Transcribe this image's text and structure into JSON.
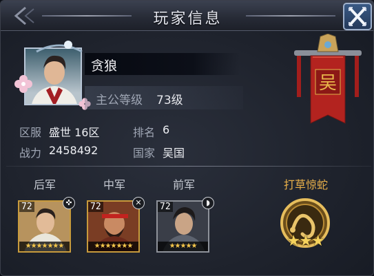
{
  "header": {
    "title": "玩家信息"
  },
  "player": {
    "name": "贪狼",
    "level_label": "主公等级",
    "level_value": "73级",
    "info": {
      "server_label": "区服",
      "server_value": "盛世 16区",
      "rank_label": "排名",
      "rank_value": "6",
      "power_label": "战力",
      "power_value": "2458492",
      "nation_label": "国家",
      "nation_value": "吴国"
    }
  },
  "banner": {
    "glyph": "吴",
    "color": "#b3231f"
  },
  "armies": [
    {
      "title": "后军",
      "hero_level": "72",
      "stars": "★★★★★★★",
      "badge": "✜"
    },
    {
      "title": "中军",
      "hero_level": "72",
      "stars": "★★★★★★★",
      "badge": "✕"
    },
    {
      "title": "前军",
      "hero_level": "72",
      "stars": "★★★★★",
      "badge": "◗"
    }
  ],
  "skill": {
    "title": "打草惊蛇",
    "stars": "★★★",
    "glyph": "艹"
  },
  "colors": {
    "accent_gold": "#e9b04a",
    "card_border": "#c89b3c",
    "close_blue": "#2e4a72"
  }
}
